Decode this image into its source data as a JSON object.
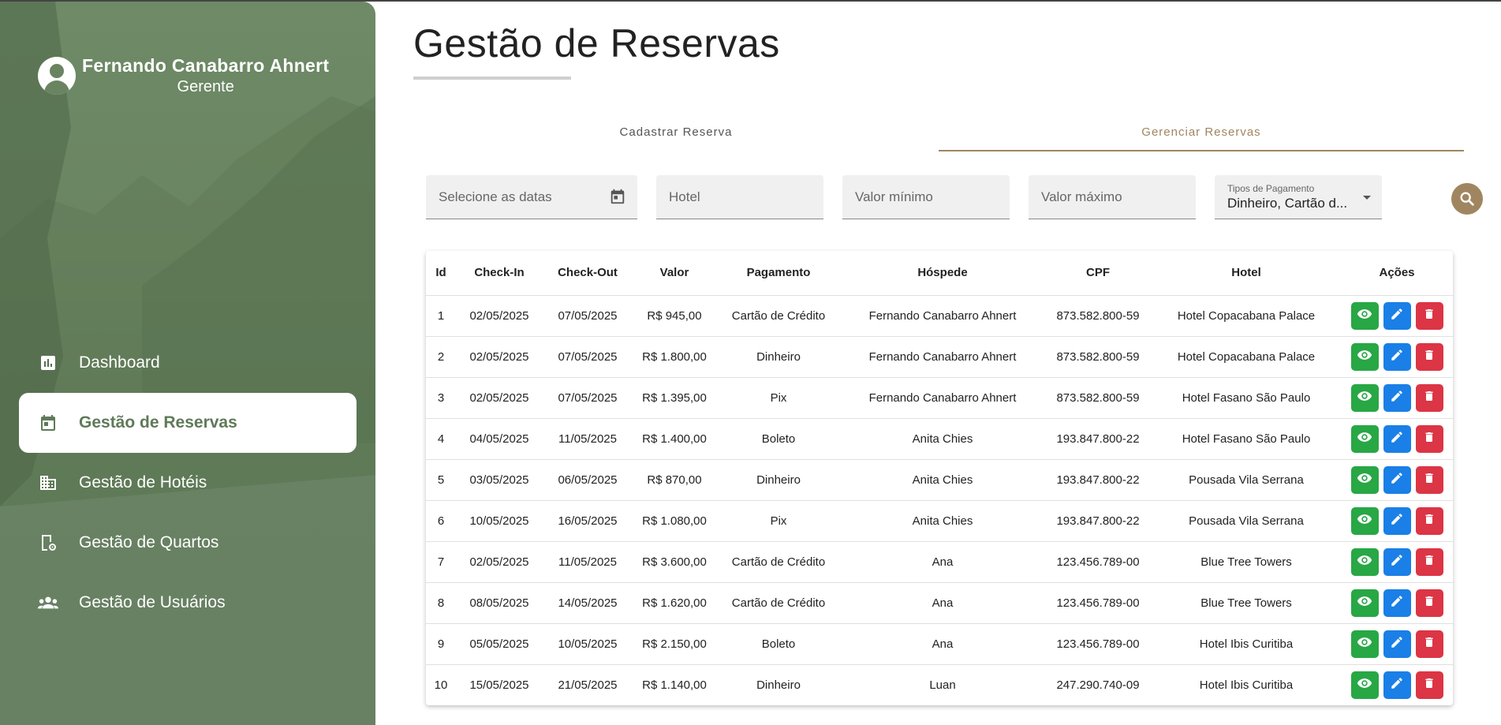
{
  "user": {
    "name": "Fernando Canabarro Ahnert",
    "role": "Gerente"
  },
  "nav": [
    {
      "label": "Dashboard",
      "icon": "chart-icon",
      "active": false
    },
    {
      "label": "Gestão de Reservas",
      "icon": "calendar-icon",
      "active": true
    },
    {
      "label": "Gestão de Hotéis",
      "icon": "building-icon",
      "active": false
    },
    {
      "label": "Gestão de Quartos",
      "icon": "room-settings-icon",
      "active": false
    },
    {
      "label": "Gestão de Usuários",
      "icon": "users-icon",
      "active": false
    }
  ],
  "page": {
    "title": "Gestão de Reservas"
  },
  "tabs": [
    {
      "label": "Cadastrar Reserva",
      "active": false
    },
    {
      "label": "Gerenciar Reservas",
      "active": true
    }
  ],
  "filters": {
    "dates_placeholder": "Selecione as datas",
    "hotel_placeholder": "Hotel",
    "min_placeholder": "Valor mínimo",
    "max_placeholder": "Valor máximo",
    "payment_label": "Tipos de Pagamento",
    "payment_value": "Dinheiro, Cartão d..."
  },
  "table": {
    "headers": [
      "Id",
      "Check-In",
      "Check-Out",
      "Valor",
      "Pagamento",
      "Hóspede",
      "CPF",
      "Hotel",
      "Ações"
    ],
    "rows": [
      [
        "1",
        "02/05/2025",
        "07/05/2025",
        "R$ 945,00",
        "Cartão de Crédito",
        "Fernando Canabarro Ahnert",
        "873.582.800-59",
        "Hotel Copacabana Palace"
      ],
      [
        "2",
        "02/05/2025",
        "07/05/2025",
        "R$ 1.800,00",
        "Dinheiro",
        "Fernando Canabarro Ahnert",
        "873.582.800-59",
        "Hotel Copacabana Palace"
      ],
      [
        "3",
        "02/05/2025",
        "07/05/2025",
        "R$ 1.395,00",
        "Pix",
        "Fernando Canabarro Ahnert",
        "873.582.800-59",
        "Hotel Fasano São Paulo"
      ],
      [
        "4",
        "04/05/2025",
        "11/05/2025",
        "R$ 1.400,00",
        "Boleto",
        "Anita Chies",
        "193.847.800-22",
        "Hotel Fasano São Paulo"
      ],
      [
        "5",
        "03/05/2025",
        "06/05/2025",
        "R$ 870,00",
        "Dinheiro",
        "Anita Chies",
        "193.847.800-22",
        "Pousada Vila Serrana"
      ],
      [
        "6",
        "10/05/2025",
        "16/05/2025",
        "R$ 1.080,00",
        "Pix",
        "Anita Chies",
        "193.847.800-22",
        "Pousada Vila Serrana"
      ],
      [
        "7",
        "02/05/2025",
        "11/05/2025",
        "R$ 3.600,00",
        "Cartão de Crédito",
        "Ana",
        "123.456.789-00",
        "Blue Tree Towers"
      ],
      [
        "8",
        "08/05/2025",
        "14/05/2025",
        "R$ 1.620,00",
        "Cartão de Crédito",
        "Ana",
        "123.456.789-00",
        "Blue Tree Towers"
      ],
      [
        "9",
        "05/05/2025",
        "10/05/2025",
        "R$ 2.150,00",
        "Boleto",
        "Ana",
        "123.456.789-00",
        "Hotel Ibis Curitiba"
      ],
      [
        "10",
        "15/05/2025",
        "21/05/2025",
        "R$ 1.140,00",
        "Dinheiro",
        "Luan",
        "247.290.740-09",
        "Hotel Ibis Curitiba"
      ]
    ],
    "row_actions": [
      "eye-icon",
      "pencil-icon",
      "trash-icon"
    ]
  },
  "colors": {
    "sidebar": "#6a8461",
    "accent": "#a08660",
    "view": "#28a745",
    "edit": "#1a7fe6",
    "delete": "#dc3545"
  }
}
